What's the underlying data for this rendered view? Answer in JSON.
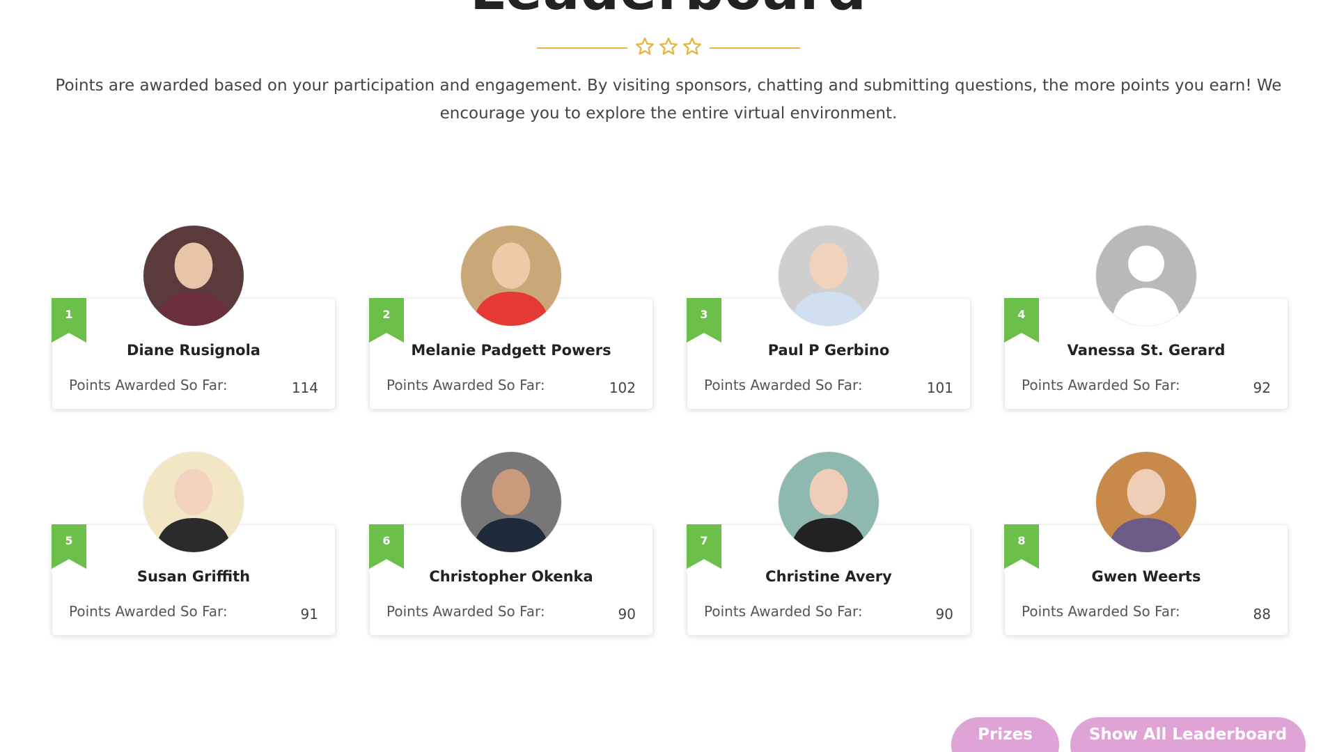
{
  "page": {
    "title": "Leaderboard",
    "intro": "Points are awarded based on your participation and engagement. By visiting sponsors, chatting and submitting questions, the more points you earn! We encourage you to explore the entire virtual environment.",
    "divider_icon": "star-icon",
    "accent_color": "#e8b23c"
  },
  "leaderboard": {
    "points_label": "Points Awarded So Far:",
    "ribbon_color": "#6cbf4b",
    "entries": [
      {
        "rank": "1",
        "name": "Diane Rusignola",
        "points": "114",
        "avatar": "photo"
      },
      {
        "rank": "2",
        "name": "Melanie Padgett Powers",
        "points": "102",
        "avatar": "photo"
      },
      {
        "rank": "3",
        "name": "Paul P Gerbino",
        "points": "101",
        "avatar": "photo"
      },
      {
        "rank": "4",
        "name": "Vanessa St. Gerard",
        "points": "92",
        "avatar": "default-user-icon"
      },
      {
        "rank": "5",
        "name": "Susan Griffith",
        "points": "91",
        "avatar": "photo"
      },
      {
        "rank": "6",
        "name": "Christopher Okenka",
        "points": "90",
        "avatar": "photo"
      },
      {
        "rank": "7",
        "name": "Christine Avery",
        "points": "90",
        "avatar": "photo"
      },
      {
        "rank": "8",
        "name": "Gwen Weerts",
        "points": "88",
        "avatar": "photo"
      }
    ]
  },
  "buttons": {
    "prizes": "Prizes",
    "show_all": "Show All Leaderboard",
    "color": "#dfa3d6"
  }
}
